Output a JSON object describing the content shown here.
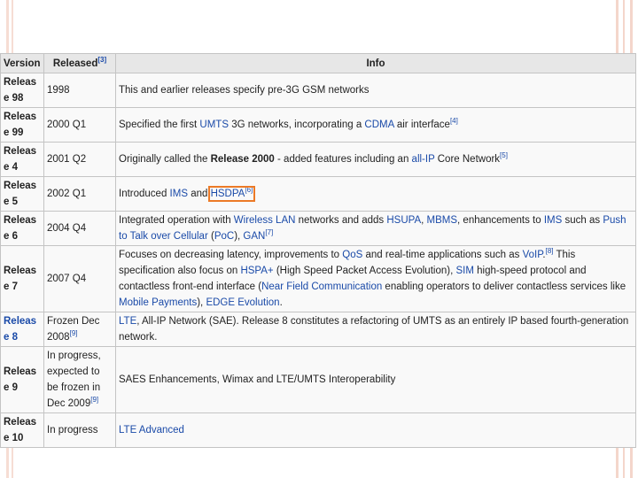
{
  "columns": [
    {
      "label": "Version",
      "ref": ""
    },
    {
      "label": "Released",
      "ref": "[3]"
    },
    {
      "label": "Info",
      "ref": ""
    }
  ],
  "rows": [
    {
      "version": "Release 98",
      "version_link": false,
      "released": "1998",
      "released_ref": "",
      "info": [
        {
          "t": "This and earlier releases specify pre-3G GSM networks"
        }
      ]
    },
    {
      "version": "Release 99",
      "version_link": false,
      "released": "2000 Q1",
      "released_ref": "",
      "info": [
        {
          "t": "Specified the first "
        },
        {
          "t": "UMTS",
          "link": true
        },
        {
          "t": " 3G networks, incorporating a "
        },
        {
          "t": "CDMA",
          "link": true
        },
        {
          "t": " air interface"
        },
        {
          "t": "[4]",
          "sup": true
        }
      ]
    },
    {
      "version": "Release 4",
      "version_link": false,
      "released": "2001 Q2",
      "released_ref": "",
      "info": [
        {
          "t": "Originally called the "
        },
        {
          "t": "Release 2000",
          "bold": true
        },
        {
          "t": " - added features including an "
        },
        {
          "t": "all-IP",
          "link": true
        },
        {
          "t": " Core Network"
        },
        {
          "t": "[5]",
          "sup": true
        }
      ]
    },
    {
      "version": "Release 5",
      "version_link": false,
      "released": "2002 Q1",
      "released_ref": "",
      "info": [
        {
          "t": "Introduced "
        },
        {
          "t": "IMS",
          "link": true
        },
        {
          "t": " and "
        },
        {
          "t": "HSDPA",
          "link": true,
          "highlight": true,
          "sup_in": "[6]"
        }
      ]
    },
    {
      "version": "Release 6",
      "version_link": false,
      "released": "2004 Q4",
      "released_ref": "",
      "info": [
        {
          "t": "Integrated operation with "
        },
        {
          "t": "Wireless LAN",
          "link": true
        },
        {
          "t": " networks and adds "
        },
        {
          "t": "HSUPA",
          "link": true
        },
        {
          "t": ", "
        },
        {
          "t": "MBMS",
          "link": true
        },
        {
          "t": ", enhancements to "
        },
        {
          "t": "IMS",
          "link": true
        },
        {
          "t": " such as "
        },
        {
          "t": "Push to Talk over Cellular",
          "link": true
        },
        {
          "t": " ("
        },
        {
          "t": "PoC",
          "link": true
        },
        {
          "t": "), "
        },
        {
          "t": "GAN",
          "link": true
        },
        {
          "t": "[7]",
          "sup": true
        }
      ]
    },
    {
      "version": "Release 7",
      "version_link": false,
      "released": "2007 Q4",
      "released_ref": "",
      "info": [
        {
          "t": "Focuses on decreasing latency, improvements to "
        },
        {
          "t": "QoS",
          "link": true
        },
        {
          "t": " and real-time applications such as "
        },
        {
          "t": "VoIP",
          "link": true
        },
        {
          "t": "."
        },
        {
          "t": "[8]",
          "sup": true
        },
        {
          "t": " This specification also focus on "
        },
        {
          "t": "HSPA+",
          "link": true
        },
        {
          "t": " (High Speed Packet Access Evolution), "
        },
        {
          "t": "SIM",
          "link": true
        },
        {
          "t": " high-speed protocol and contactless front-end interface ("
        },
        {
          "t": "Near Field Communication",
          "link": true
        },
        {
          "t": " enabling operators to deliver contactless services like "
        },
        {
          "t": "Mobile Payments",
          "link": true
        },
        {
          "t": "), "
        },
        {
          "t": "EDGE Evolution",
          "link": true
        },
        {
          "t": "."
        }
      ]
    },
    {
      "version": "Release 8",
      "version_link": true,
      "released": "Frozen Dec 2008",
      "released_ref": "[9]",
      "info": [
        {
          "t": "LTE",
          "link": true
        },
        {
          "t": ", All-IP Network (SAE). Release 8 constitutes a refactoring of UMTS as an entirely IP based fourth-generation network."
        }
      ]
    },
    {
      "version": "Release 9",
      "version_link": false,
      "released": "In progress, expected to be frozen in Dec 2009",
      "released_ref": "[9]",
      "info": [
        {
          "t": "SAES Enhancements, Wimax and LTE/UMTS Interoperability"
        }
      ]
    },
    {
      "version": "Release 10",
      "version_link": false,
      "released": "In progress",
      "released_ref": "",
      "info": [
        {
          "t": "LTE Advanced",
          "link": true
        }
      ]
    }
  ],
  "colors": {
    "link": "#1a4aa8",
    "highlight": "#ec7a27",
    "header_bg": "#e7e7e7",
    "cell_bg": "#f9f9f9",
    "frame": "#f4d6cb"
  }
}
